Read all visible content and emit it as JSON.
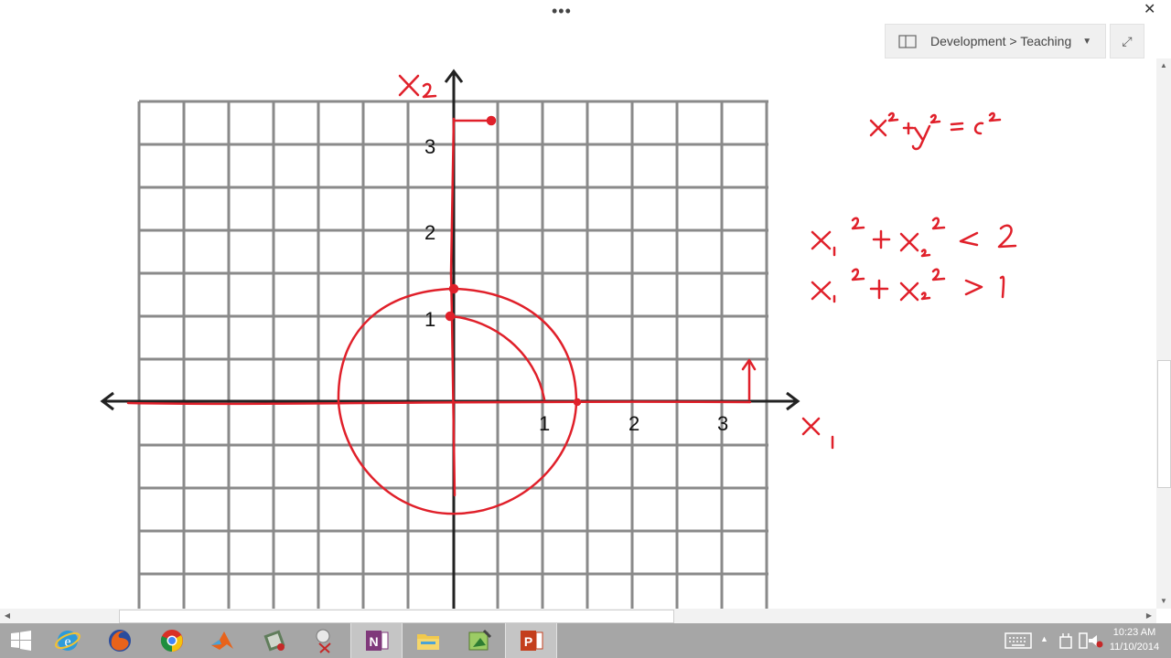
{
  "window": {
    "more_label": "•••",
    "close_label": "✕",
    "section": "Development > Teaching",
    "caret": "▼",
    "expand_icon": "⤢"
  },
  "graph": {
    "x_ticks": [
      "1",
      "2",
      "3"
    ],
    "y_ticks": [
      "1",
      "2",
      "3"
    ]
  },
  "ink_annotations": [
    "x² + y² = c²",
    "x₁² + x₂² < 2",
    "x₁² + x₂² > 1",
    "x₁",
    "x₂"
  ],
  "scrollbars": {
    "up": "▲",
    "down": "▼",
    "left": "◀",
    "right": "▶"
  },
  "taskbar": {
    "apps": [
      "windows-start",
      "internet-explorer",
      "firefox",
      "chrome",
      "matlab",
      "notepad-edit",
      "snipping-tool",
      "onenote",
      "file-explorer",
      "paint-tool",
      "powerpoint"
    ],
    "time": "10:23 AM",
    "date": "11/10/2014"
  },
  "colors": {
    "ink": "#e0202a",
    "grid": "#8a8a8a",
    "taskbar": "#a6a6a6"
  }
}
